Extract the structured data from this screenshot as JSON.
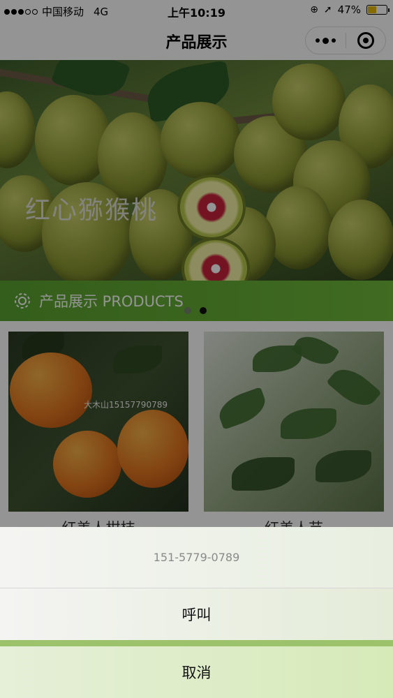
{
  "status_bar": {
    "carrier": "中国移动",
    "network": "4G",
    "time": "上午10:19",
    "battery": "47%",
    "battery_level": 0.47
  },
  "nav": {
    "title": "产品展示"
  },
  "banner": {
    "text": "红心猕猴桃",
    "slides": 2,
    "active_slide": 2
  },
  "section": {
    "title": "产品展示 PRODUCTS",
    "icon": "gear-icon"
  },
  "products": [
    {
      "name": "红美人柑桔",
      "watermark": "大木山15157790789"
    },
    {
      "name": "红美人苗"
    }
  ],
  "action_sheet": {
    "phone": "151-5779-0789",
    "call_label": "呼叫",
    "cancel_label": "取消"
  },
  "colors": {
    "accent_green": "#5aa22f",
    "mask": "rgba(0,0,0,0.42)"
  }
}
